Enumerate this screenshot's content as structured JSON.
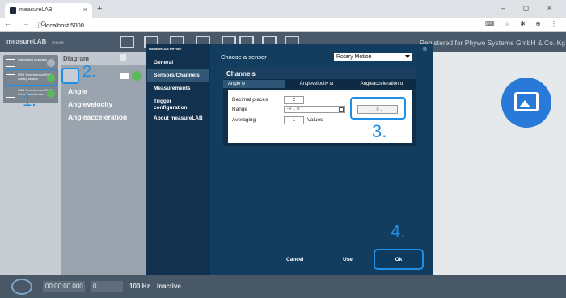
{
  "browser": {
    "tab_title": "measureLAB",
    "tab_close": "×",
    "new_tab": "+",
    "nav_icons": "← → C",
    "url_icon": "ⓘ",
    "url": "localhost:5000",
    "window_controls": "– ◻ ×",
    "ext_icons": "⌨ ☆ ✱ ⊕ ⋮"
  },
  "app": {
    "logo": "measureLAB",
    "logo_sub": "PHYWE",
    "registered": "Registered for Phywe Systeme GmbH & Co. Kg"
  },
  "left": {
    "channels": [
      {
        "label": "Calculated channels",
        "active": false
      },
      {
        "label": "USB Smartsensor 0001 - Rotary Motion",
        "active": true
      },
      {
        "label": "USB Smartsensor 0702 - Force Acceleration",
        "active": true
      }
    ]
  },
  "diagram": {
    "title": "Diagram",
    "items": [
      "Angle",
      "Anglevelocity",
      "Angleacceleration"
    ]
  },
  "modal": {
    "logo": "measureLAB PHYWE",
    "nav": [
      "General",
      "Sensors/Channels",
      "Measurements",
      "Trigger configuration",
      "About measureLAB"
    ],
    "choose_label": "Choose a sensor",
    "sensor": "Rotary Motion",
    "channels_title": "Channels",
    "tabs": [
      "Angle φ",
      "Anglevelocity ω",
      "Angleacceleration α"
    ],
    "decimal_label": "Decimal places",
    "decimal_value": "2",
    "range_label": "Range",
    "range_value": "-∞ .. ∞ °",
    "averaging_label": "Averaging",
    "averaging_value": "1",
    "values_label": "Values",
    "zero_button": "→ 0 ←",
    "cancel": "Cancel",
    "use": "Use",
    "ok": "Ok"
  },
  "status": {
    "timer": "00:00:00.000",
    "count": "0",
    "rate": "100 Hz",
    "state": "Inactive"
  },
  "annotations": [
    "1.",
    "2.",
    "3.",
    "4."
  ],
  "colors": {
    "annotation": "#1e8ee6",
    "modal_bg": "#123d5e",
    "header_bg": "#4a5a6a"
  }
}
